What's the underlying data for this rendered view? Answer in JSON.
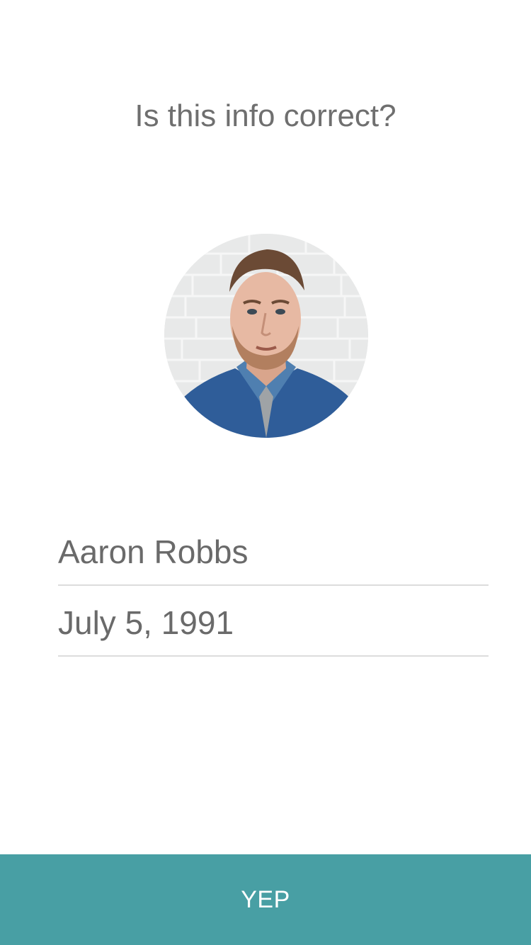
{
  "prompt": {
    "title": "Is this info correct?"
  },
  "profile": {
    "name": "Aaron Robbs",
    "date_of_birth": "July 5, 1991"
  },
  "actions": {
    "confirm_label": "YEP"
  },
  "colors": {
    "accent": "#489fa4",
    "text": "#6a6a6a",
    "divider": "#dcdcdc"
  }
}
